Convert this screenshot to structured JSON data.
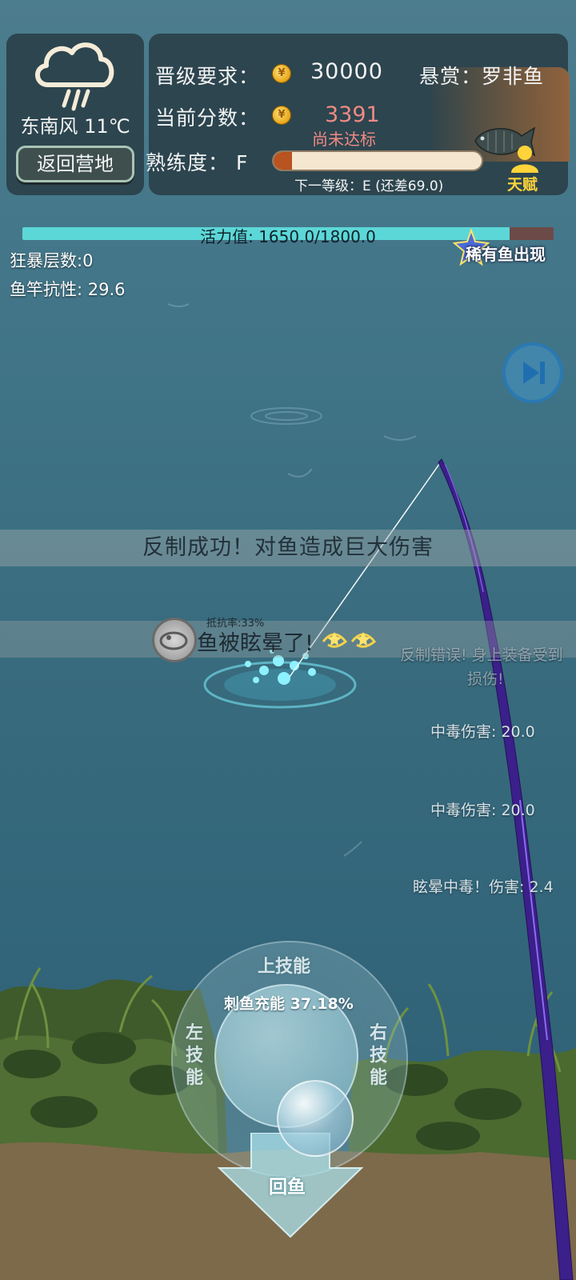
{
  "weather": {
    "icon": "rain-cloud-icon",
    "text": "东南风 11℃",
    "camp_button": "返回营地"
  },
  "score": {
    "req_label": "晋级要求：",
    "req_value": "30000",
    "cur_label": "当前分数：",
    "cur_value": "3391",
    "cur_status": "尚未达标",
    "bounty_label": "悬赏：罗非鱼",
    "prof_label": "熟练度：",
    "prof_grade": "F",
    "prof_progress": 0.09,
    "next_level": "下一等级：E (还差69.0)",
    "talent_label": "天赋",
    "coin_symbol": "¥"
  },
  "vitality": {
    "label": "活力值: 1650.0/1800.0",
    "current": 1650.0,
    "max": 1800.0
  },
  "stats": {
    "rage": "狂暴层数:0",
    "rod_resist": "鱼竿抗性: 29.6",
    "rare_fish": "稀有鱼出现"
  },
  "banners": {
    "counter_success": "反制成功！对鱼造成巨大伤害",
    "stunned": "鱼被眩晕了!"
  },
  "floating": {
    "resist_small": "抵抗率:33%",
    "counter_error_1": "反制错误! 身上装备受到",
    "counter_error_2": "损伤!",
    "poison_1": "中毒伤害: 20.0",
    "poison_2": "中毒伤害: 20.0",
    "stun_poison": "眩晕中毒！伤害: 2.4"
  },
  "skills": {
    "up": "上技能",
    "left": "左技能",
    "right": "右技能",
    "charge": "刺鱼充能 37.18%",
    "reel": "回鱼"
  },
  "colors": {
    "water": "#3f7386",
    "panel": "#283c44",
    "vitality": "#5cd7d7",
    "score_warn": "#f08a84",
    "rod": "#3b1f8a"
  }
}
